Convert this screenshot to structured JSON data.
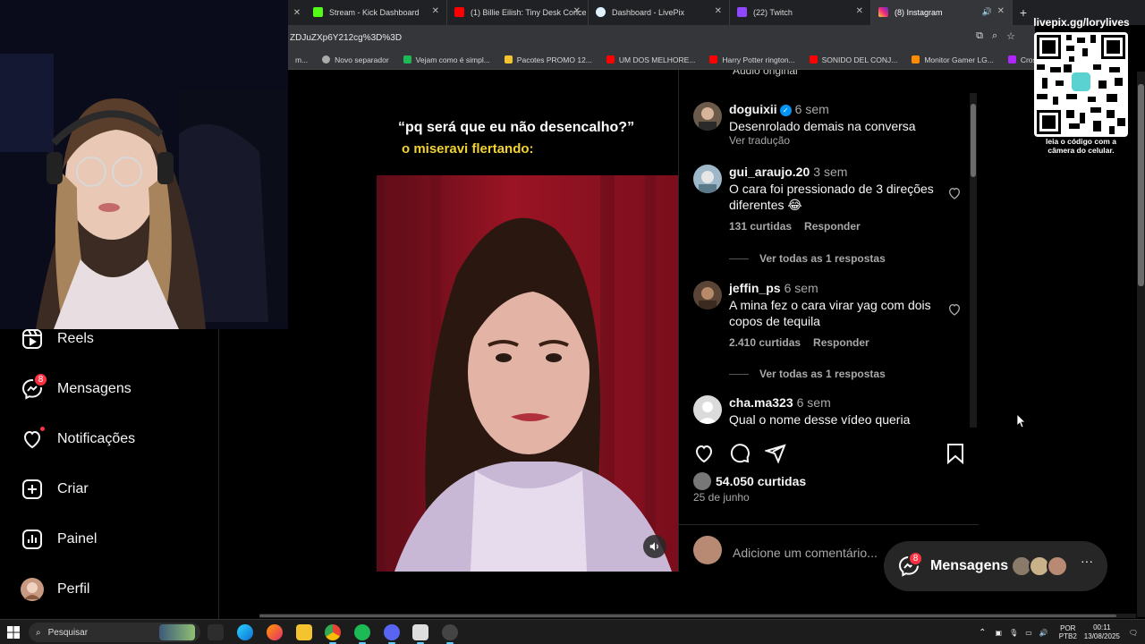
{
  "browser": {
    "tabs": [
      {
        "title": "Stream - Kick Dashboard",
        "color": "#53fc18"
      },
      {
        "title": "(1) Billie Eilish: Tiny Desk Conce",
        "color": "#ff0000"
      },
      {
        "title": "Dashboard - LivePix",
        "color": "#e0f2ff"
      },
      {
        "title": "(22) Twitch",
        "color": "#9146ff"
      },
      {
        "title": "(8) Instagram",
        "color": "#e1306c",
        "active": true
      }
    ],
    "url": "ZDJuZXp6Y212cg%3D%3D",
    "bookmarks": [
      {
        "label": "m...",
        "color": "#888888"
      },
      {
        "label": "Novo separador",
        "color": "#aaaaaa"
      },
      {
        "label": "Vejam como é simpl...",
        "color": "#1db954"
      },
      {
        "label": "Pacotes PROMO 12...",
        "color": "#f4c430"
      },
      {
        "label": "UM DOS MELHORE...",
        "color": "#ff0000"
      },
      {
        "label": "Harry Potter rington...",
        "color": "#ff0000"
      },
      {
        "label": "SONIDO DEL CONJ...",
        "color": "#ff0000"
      },
      {
        "label": "Monitor Gamer LG...",
        "color": "#ff8c00"
      },
      {
        "label": "Crossclip",
        "color": "#b026ff"
      }
    ]
  },
  "qr": {
    "title": "livepix.gg/lorylives",
    "caption": "leia o código com a câmera do celular."
  },
  "nav": {
    "items": [
      {
        "label": "Reels",
        "icon": "reels-icon"
      },
      {
        "label": "Mensagens",
        "icon": "messenger-icon",
        "badge": "8"
      },
      {
        "label": "Notificações",
        "icon": "heart-icon",
        "dot": true
      },
      {
        "label": "Criar",
        "icon": "plus-square-icon"
      },
      {
        "label": "Painel",
        "icon": "dashboard-icon"
      },
      {
        "label": "Perfil",
        "icon": "avatar"
      }
    ]
  },
  "post": {
    "caption_line1": "“pq será que eu não desencalho?”",
    "caption_line2": "o miseravi flertando:",
    "audio": "Áudio original",
    "comments": [
      {
        "user": "doguixii",
        "verified": true,
        "time": "6 sem",
        "text": "Desenrolado demais na conversa",
        "translate": "Ver tradução",
        "avatar_color": "#6b5a4a"
      },
      {
        "user": "gui_araujo.20",
        "time": "3 sem",
        "text": "O cara foi pressionado de 3 direções diferentes 😂",
        "likes": "131 curtidas",
        "reply": "Responder",
        "replies": "Ver todas as 1 respostas",
        "avatar_color": "#9fb8c9"
      },
      {
        "user": "jeffin_ps",
        "time": "6 sem",
        "text": "A mina fez o cara virar yag com dois copos de tequila",
        "likes": "2.410 curtidas",
        "reply": "Responder",
        "replies": "Ver todas as 1 respostas",
        "avatar_color": "#5a4436"
      },
      {
        "user": "cha.ma323",
        "time": "6 sem",
        "text": "Qual o nome desse vídeo queria",
        "avatar_color": "#dbdbdb"
      }
    ],
    "likes": "54.050 curtidas",
    "date": "25 de junho",
    "add_comment_placeholder": "Adicione um comentário..."
  },
  "messages_float": {
    "label": "Mensagens",
    "badge": "8"
  },
  "taskbar": {
    "search": "Pesquisar",
    "lang1": "POR",
    "lang2": "PTB2",
    "time": "00:11",
    "date": "13/08/2025"
  }
}
